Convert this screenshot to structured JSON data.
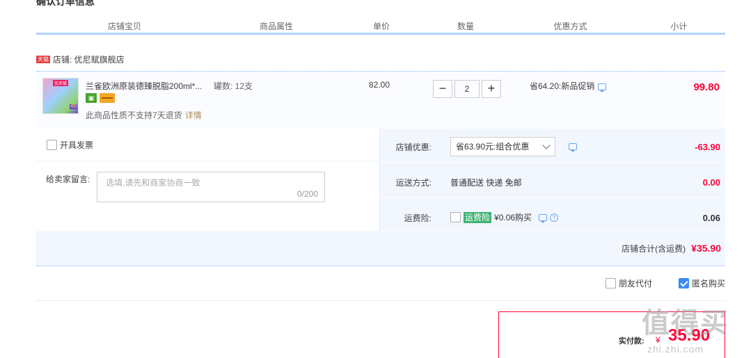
{
  "page": {
    "title": "确认订单信息"
  },
  "headers": [
    "店铺宝贝",
    "商品属性",
    "单价",
    "数量",
    "优惠方式",
    "小计"
  ],
  "shop": {
    "badge": "天猫",
    "label": "店铺: 优尼赋旗舰店"
  },
  "item": {
    "thumb_top": "优尼赋",
    "thumb_tag": "49",
    "title": "兰雀欧洲原装德臻脱脂200ml*...",
    "attr": "罐数: 12支",
    "price": "82.00",
    "qty_minus": "−",
    "qty": "2",
    "qty_plus": "+",
    "promo": "省64.20:新品促销",
    "subtotal": "99.80",
    "note": "此商品性质不支持7天退货",
    "note_link": "详情",
    "badge_green": "▣"
  },
  "invoice": {
    "label": "开具发票"
  },
  "message": {
    "label": "给卖家留言:",
    "placeholder": "选填,请先和商家协商一致",
    "count": "0/200"
  },
  "discount": {
    "label": "店铺优惠:",
    "selected": "省63.90元:组合优惠",
    "value": "-63.90"
  },
  "shipping": {
    "label": "运送方式:",
    "method": "普通配送 快递 免邮",
    "value": "0.00"
  },
  "insurance": {
    "label": "运费险:",
    "tag": "运费险",
    "price": "¥0.06购买",
    "value": "0.06",
    "help": "?"
  },
  "shop_total": {
    "label": "店铺合计(含运费)",
    "value": "¥35.90"
  },
  "options": {
    "friend_pay": "朋友代付",
    "anonymous": "匿名购买"
  },
  "payment": {
    "label": "实付款:",
    "currency": "¥",
    "value": "35.90"
  },
  "watermark": {
    "main": "值得买",
    "sub": "zhi.zhi.com"
  },
  "colors": {
    "accent": "#ff0036",
    "border_blue": "#b2d1ff",
    "bg_light": "#f2f7ff"
  }
}
